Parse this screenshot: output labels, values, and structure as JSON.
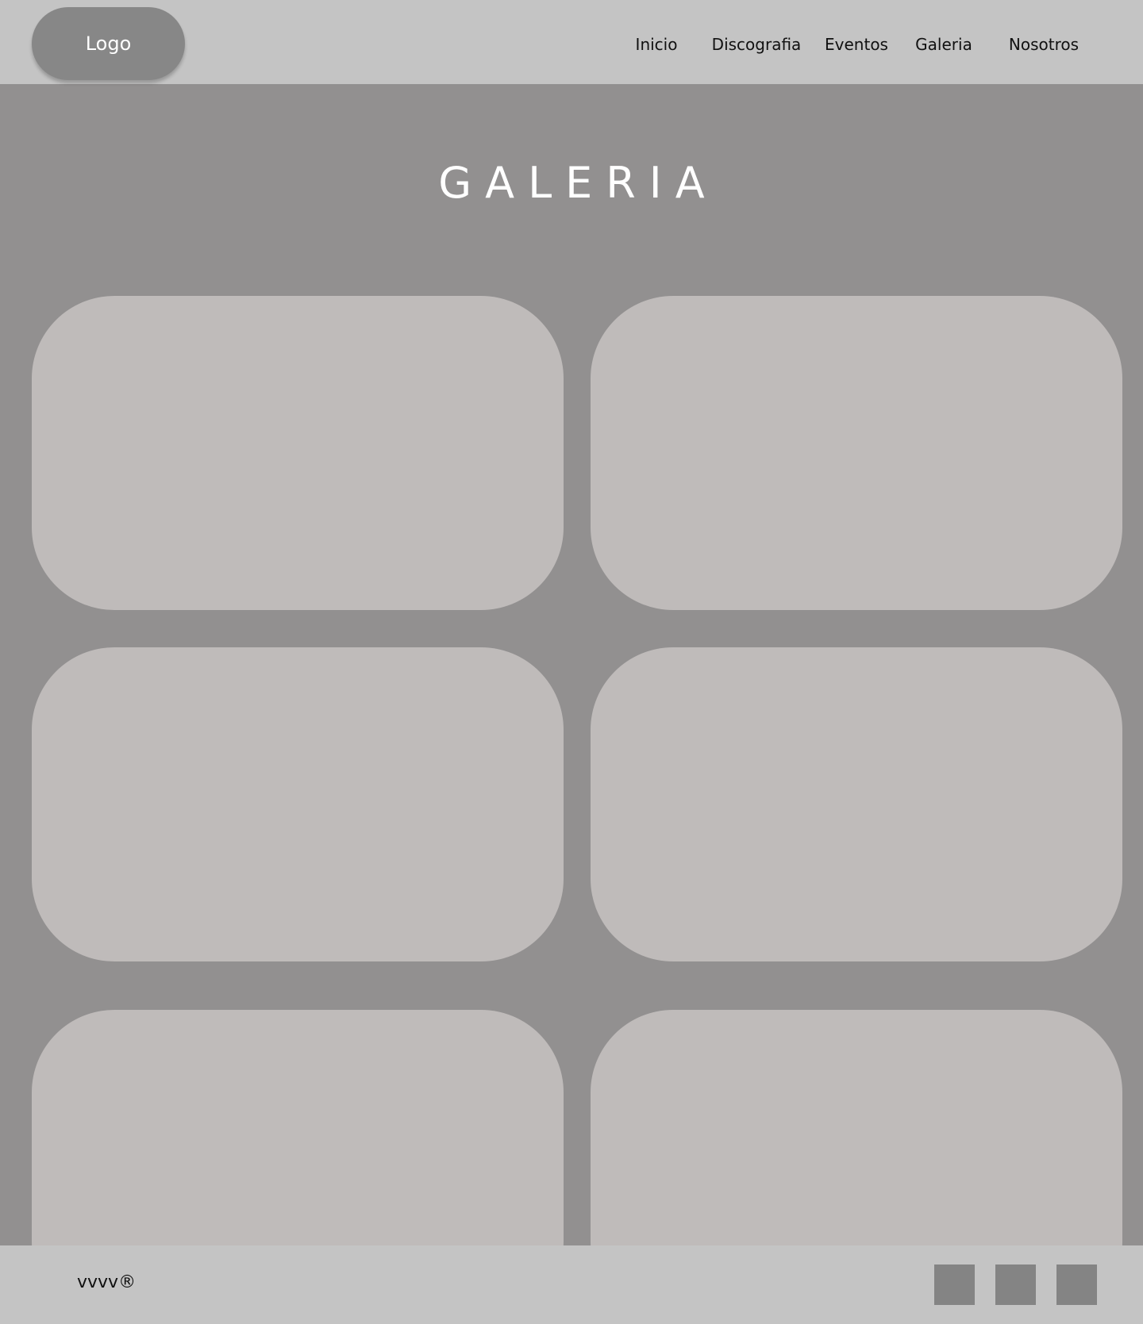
{
  "header": {
    "logo_label": "Logo",
    "nav": {
      "inicio": "Inicio",
      "discografia": "Discografia",
      "eventos": "Eventos",
      "galeria": "Galeria",
      "nosotros": "Nosotros"
    }
  },
  "main": {
    "title": "GALERIA",
    "gallery_count": 6
  },
  "footer": {
    "copyright": "vvvv®",
    "social_icons": [
      "social-link",
      "social-link",
      "social-link"
    ]
  },
  "colors": {
    "header_bg": "#c4c4c4",
    "page_bg": "#929090",
    "card_bg": "#bfbbba",
    "logo_bg": "#878787",
    "social_bg": "#848484"
  }
}
